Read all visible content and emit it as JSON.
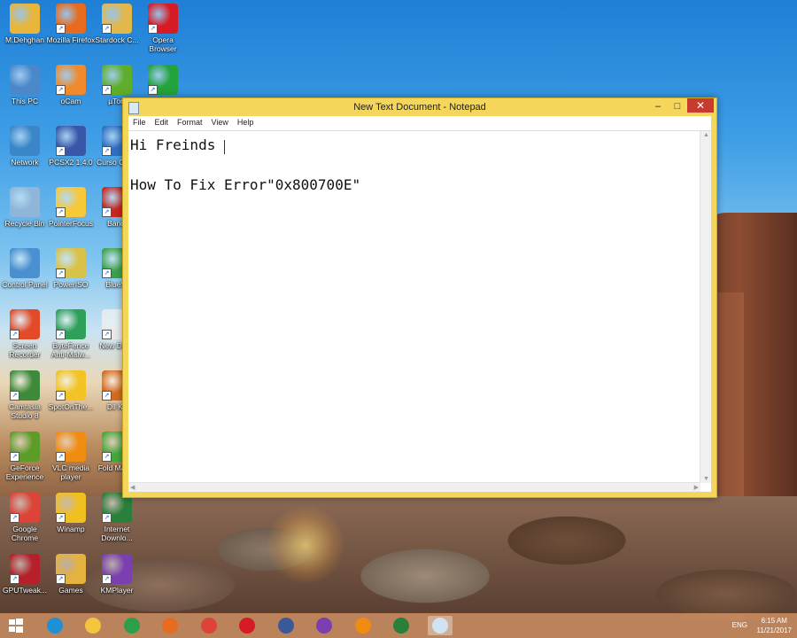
{
  "desktop": {
    "icons": [
      {
        "label": "M.Dehghan",
        "color": "#e8b63a"
      },
      {
        "label": "Mozilla Firefox",
        "color": "#e66b1f"
      },
      {
        "label": "Stardock C...",
        "color": "#e2b84b"
      },
      {
        "label": "Opera Browser",
        "color": "#d61b24"
      },
      {
        "label": "This PC",
        "color": "#4a88c9"
      },
      {
        "label": "oCam",
        "color": "#f08a2c"
      },
      {
        "label": "µTorr",
        "color": "#5fae2b"
      },
      {
        "label": "",
        "color": "#23a33b"
      },
      {
        "label": "Network",
        "color": "#3a86c8"
      },
      {
        "label": "PCSX2 1.4.0",
        "color": "#3a56a8"
      },
      {
        "label": "Curso Contr",
        "color": "#2f6fc0"
      },
      {
        "label": "Recycle Bin",
        "color": "#8fb6d8"
      },
      {
        "label": "PointerFocus",
        "color": "#f6c83a"
      },
      {
        "label": "Bandi",
        "color": "#c8261e"
      },
      {
        "label": "Control Panel",
        "color": "#4a8fd0"
      },
      {
        "label": "PowerISO",
        "color": "#d9c24a"
      },
      {
        "label": "BlueSt",
        "color": "#3ba24a"
      },
      {
        "label": "Screen Recorder",
        "color": "#e14b2a"
      },
      {
        "label": "ByteFence Anti-Malw...",
        "color": "#2ea05a"
      },
      {
        "label": "New Docu",
        "color": "#e9e9e9"
      },
      {
        "label": "Camtasia Studio 8",
        "color": "#3f8a3a"
      },
      {
        "label": "SpotOnThe...",
        "color": "#f2c322"
      },
      {
        "label": "Dll Kit",
        "color": "#d66a1d"
      },
      {
        "label": "GeForce Experience",
        "color": "#5e9c2a"
      },
      {
        "label": "VLC media player",
        "color": "#f08c12"
      },
      {
        "label": "Fold Marke",
        "color": "#43a83a"
      },
      {
        "label": "Google Chrome",
        "color": "#db4437"
      },
      {
        "label": "Winamp",
        "color": "#f0c020"
      },
      {
        "label": "Internet Downlo...",
        "color": "#2a7f3b"
      },
      {
        "label": "GPUTweak...",
        "color": "#b5202a"
      },
      {
        "label": "Games",
        "color": "#e4b23e"
      },
      {
        "label": "KMPlayer",
        "color": "#7b3fb0"
      }
    ]
  },
  "notepad": {
    "title": "New Text Document - Notepad",
    "menu": [
      "File",
      "Edit",
      "Format",
      "View",
      "Help"
    ],
    "lines": [
      "Hi Freinds",
      "",
      "How To Fix Error\"0x800700E\""
    ],
    "buttons": {
      "minimize": "–",
      "maximize": "□",
      "close": "✕"
    }
  },
  "taskbar": {
    "apps": [
      {
        "name": "start",
        "color": "#ffffff"
      },
      {
        "name": "ie",
        "color": "#1f8fd6"
      },
      {
        "name": "file-explorer",
        "color": "#f2c53d"
      },
      {
        "name": "store",
        "color": "#2d9f4a"
      },
      {
        "name": "firefox",
        "color": "#e66b1f"
      },
      {
        "name": "chrome",
        "color": "#db4437"
      },
      {
        "name": "opera",
        "color": "#d61b24"
      },
      {
        "name": "facebook",
        "color": "#3b5998"
      },
      {
        "name": "visual-studio",
        "color": "#7b3fb0"
      },
      {
        "name": "vlc",
        "color": "#f08c12"
      },
      {
        "name": "internet-download-manager",
        "color": "#2a7f3b"
      },
      {
        "name": "notepad",
        "color": "#cfe3f2"
      }
    ],
    "lang": "ENG",
    "time": "6:15 AM",
    "date": "11/21/2017"
  }
}
